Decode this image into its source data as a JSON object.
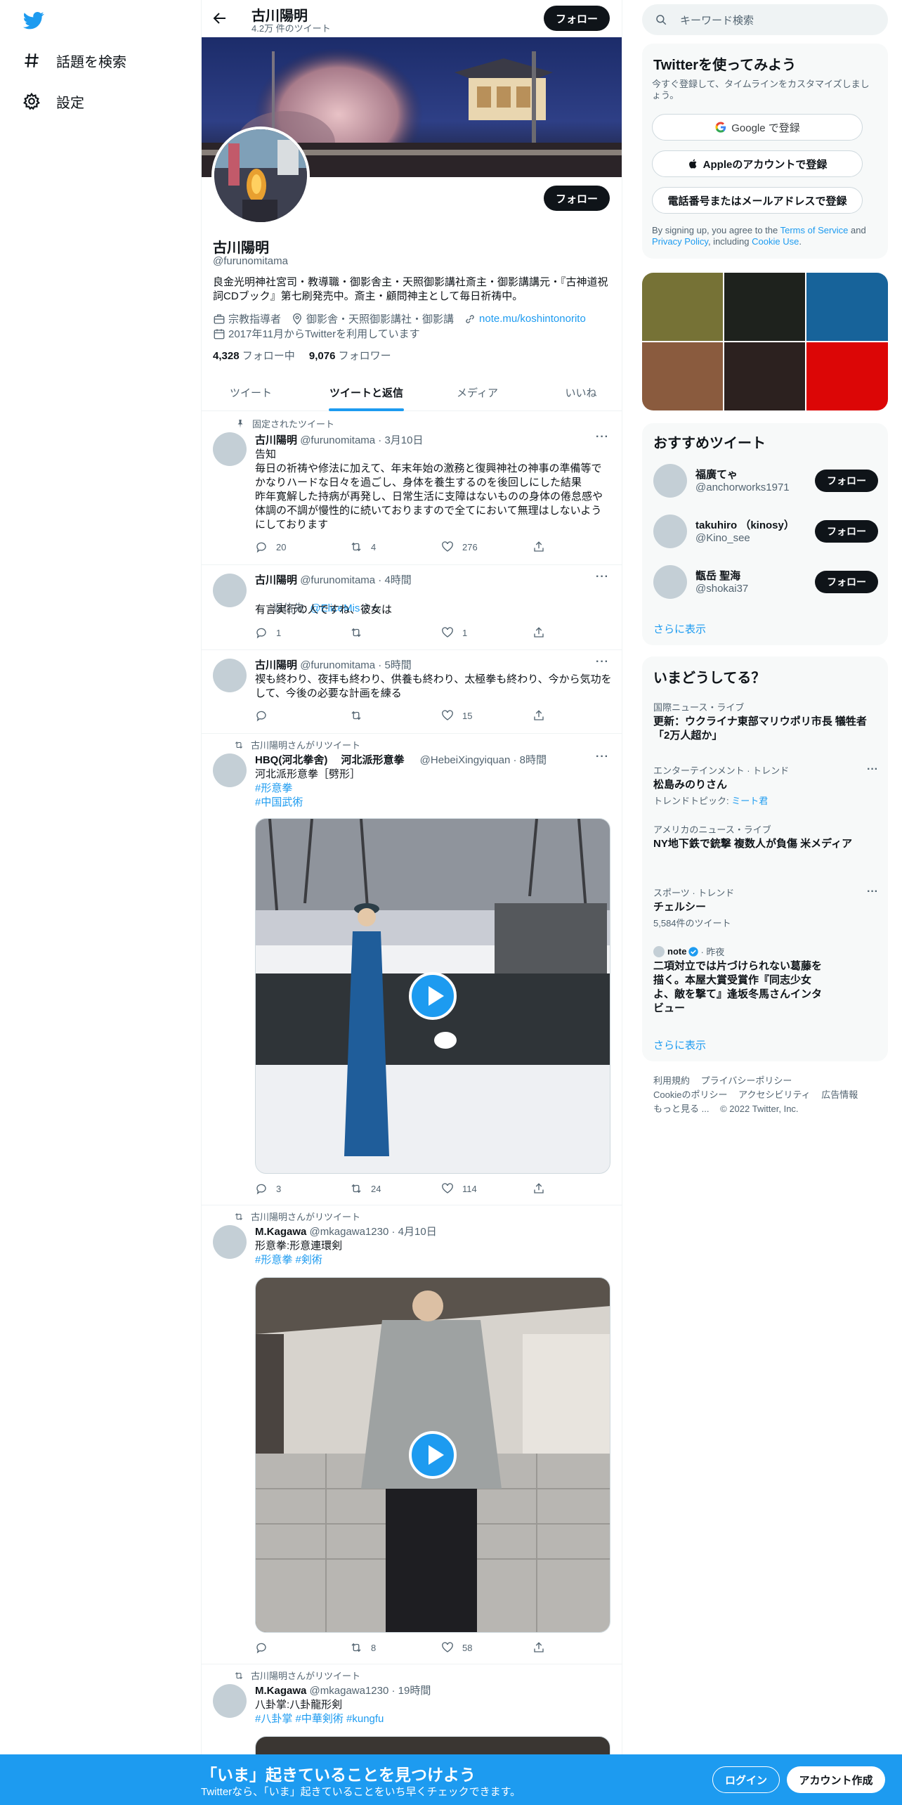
{
  "nav": {
    "explore_label": "話題を検索",
    "settings_label": "設定"
  },
  "profile": {
    "name": "古川陽明",
    "tweet_count": "4.2万 件のツイート",
    "follow_label": "フォロー",
    "handle": "@furunomitama",
    "bio": "良金光明神社宮司・教導職・御影舎主・天照御影講社斎主・御影講講元・『古神道祝詞CDブック』第七刷発売中。斎主・顧問神主として毎日祈祷中。",
    "category": "宗教指導者",
    "location": "御影舎・天照御影講社・御影講",
    "website": "note.mu/koshintonorito",
    "joined": "2017年11月からTwitterを利用しています",
    "following_count": "4,328",
    "following_label": "フォロー中",
    "followers_count": "9,076",
    "followers_label": "フォロワー"
  },
  "tabs": [
    "ツイート",
    "ツイートと返信",
    "メディア",
    "いいね"
  ],
  "tweets": [
    {
      "context": "固定されたツイート",
      "name": "古川陽明",
      "handle": "@furunomitama",
      "time": "· 3月10日",
      "body": "告知\n毎日の祈祷や修法に加えて、年末年始の激務と復興神社の神事の準備等でかなりハードな日々を過ごし、身体を養生するのを後回しにした結果\n昨年寛解した持病が再発し、日常生活に支障はないものの身体の倦怠感や体調の不調が慢性的に続いておりますので全てにおいて無理はしないようにしております",
      "reply": "20",
      "retweet": "4",
      "like": "276"
    },
    {
      "name": "古川陽明",
      "handle": "@furunomitama",
      "time": "· 4時間",
      "reply_to_prefix": "返信先: ",
      "reply_to_handle": "@EliceMis",
      "reply_to_suffix": "さん",
      "body": "有言実行の人ですね、彼女は",
      "reply": "1",
      "retweet": "",
      "like": "1"
    },
    {
      "name": "古川陽明",
      "handle": "@furunomitama",
      "time": "· 5時間",
      "body": "禊も終わり、夜拝も終わり、供養も終わり、太極拳も終わり、今から気功をして、今後の必要な計画を練る",
      "reply": "",
      "retweet": "",
      "like": "15"
    },
    {
      "context": "古川陽明さんがリツイート",
      "name": "HBQ(河北拳舍)　 河北派形意拳",
      "handle": "@HebeiXingyiquan",
      "time": "· 8時間",
      "body": "河北派形意拳［劈形］",
      "tags": "#形意拳",
      "tags2": "#中国武術",
      "reply": "3",
      "retweet": "24",
      "like": "114"
    },
    {
      "context": "古川陽明さんがリツイート",
      "name": "M.Kagawa",
      "handle": "@mkagawa1230",
      "time": "· 4月10日",
      "body": "形意拳:形意連環剣",
      "tags": "#形意拳 #剣術",
      "reply": "",
      "retweet": "8",
      "like": "58"
    },
    {
      "context": "古川陽明さんがリツイート",
      "name": "M.Kagawa",
      "handle": "@mkagawa1230",
      "time": "· 19時間",
      "body": "八卦掌:八卦龍形剣",
      "tags": "#八卦掌 #中華剣術 #kungfu"
    }
  ],
  "sidebar": {
    "search_placeholder": "キーワード検索",
    "signup": {
      "title": "Twitterを使ってみよう",
      "subtitle": "今すぐ登録して、タイムラインをカスタマイズしましょう。",
      "google": "Google で登録",
      "apple": "Appleのアカウントで登録",
      "phone": "電話番号またはメールアドレスで登録",
      "terms_pre": "By signing up, you agree to the ",
      "terms_link": "Terms of Service",
      "terms_mid": " and ",
      "privacy_link": "Privacy Policy",
      "terms_mid2": ", including ",
      "cookie_link": "Cookie Use",
      "terms_end": "."
    },
    "media_colors": [
      "#767236",
      "#1e221d",
      "#17639a",
      "#8a5b3e",
      "#2c211f",
      "#dc0606"
    ],
    "who_to_follow": {
      "title": "おすすめツイート",
      "users": [
        {
          "name": "福廣てゃ",
          "handle": "@anchorworks1971"
        },
        {
          "name": "takuhiro （kinosy）",
          "handle": "@Kino_see"
        },
        {
          "name": "甑岳 聖海",
          "handle": "@shokai37"
        }
      ],
      "follow_label": "フォロー",
      "show_more": "さらに表示"
    },
    "trends": {
      "title": "いまどうしてる？",
      "items": [
        {
          "category": "国際ニュース・ライブ",
          "text": "更新：ウクライナ東部マリウポリ市長 犠牲者「2万人超か」"
        },
        {
          "category": "エンターテインメント · トレンド",
          "text": "松島みのりさん",
          "topic_prefix": "トレンドトピック: ",
          "topic": "ミート君"
        },
        {
          "category": "アメリカのニュース・ライブ",
          "text": "NY地下鉄で銃撃 複数人が負傷 米メディア"
        },
        {
          "category": "スポーツ · トレンド",
          "text": "チェルシー",
          "count": "5,584件のツイート"
        },
        {
          "source": "note",
          "time": "· 昨夜",
          "text": "二項対立では片づけられない葛藤を描く。本屋大賞受賞作『同志少女よ、敵を撃て』逢坂冬馬さんインタビュー"
        }
      ],
      "show_more": "さらに表示"
    },
    "footer": {
      "terms": "利用規約",
      "privacy": "プライバシーポリシー",
      "cookie": "Cookieのポリシー",
      "accessibility": "アクセシビリティ",
      "ads": "広告情報",
      "more": "もっと見る ...",
      "copyright": "© 2022 Twitter, Inc."
    }
  },
  "bottom": {
    "title": "「いま」起きていることを見つけよう",
    "subtitle": "Twitterなら、「いま」起きていることをいち早くチェックできます。",
    "login": "ログイン",
    "signup": "アカウント作成"
  }
}
